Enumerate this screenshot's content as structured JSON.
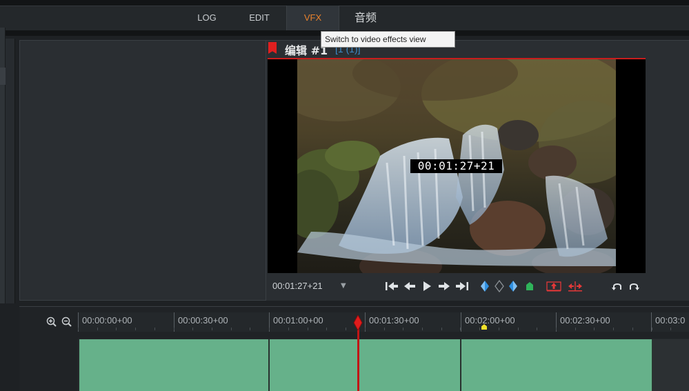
{
  "tabs": [
    {
      "id": "log",
      "label": "LOG",
      "active": false
    },
    {
      "id": "edit",
      "label": "EDIT",
      "active": false
    },
    {
      "id": "vfx",
      "label": "VFX",
      "active": true
    },
    {
      "id": "audio",
      "label": "音频",
      "active": false
    }
  ],
  "tooltip": "Switch to video effects view",
  "viewer": {
    "title": "编辑 #1",
    "subtitle": "[1 (1)]",
    "overlay_timecode": "00:01:27+21",
    "timecode": "00:01:27+21",
    "dropdown_glyph": "▼"
  },
  "timeline": {
    "ruler_labels": [
      "00:00:00+00",
      "00:00:30+00",
      "00:01:00+00",
      "00:01:30+00",
      "00:02:00+00",
      "00:02:30+00",
      "00:03:0"
    ],
    "playhead": "00:01:27+21"
  },
  "colors": {
    "accent_active_tab": "#e8812c",
    "clip": "#66b18a",
    "playhead": "#c01616",
    "marker": "#f1e12a",
    "title_link": "#3c8bc8"
  }
}
